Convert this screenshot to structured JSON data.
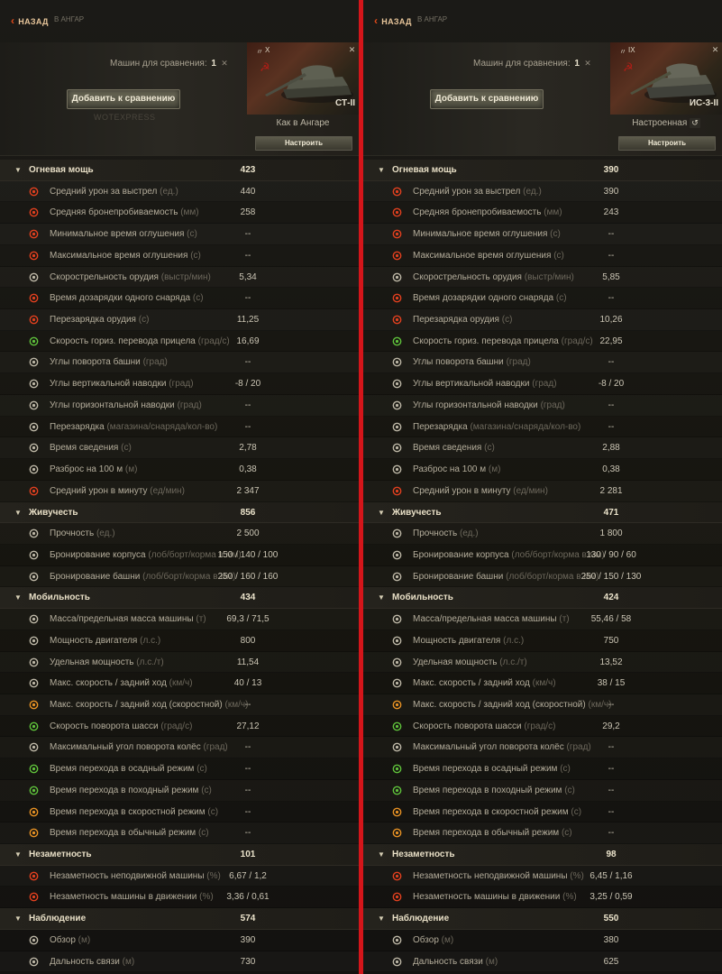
{
  "panels": [
    {
      "nav": {
        "back": "НАЗАД",
        "crumb": "В АНГАР"
      },
      "compare": {
        "label": "Машин для сравнения:",
        "count": "1",
        "add_button": "Добавить к сравнению",
        "watermark": "WOTEXPRESS"
      },
      "tank": {
        "type_mark": "〃",
        "tier": "X",
        "name": "СТ-II",
        "config": "Как в Ангаре",
        "reset": "",
        "setup_button": "Настроить"
      },
      "sections": [
        {
          "name": "Огневая мощь",
          "total": "423",
          "rows": [
            {
              "icon": "shell-damage-icon",
              "label": "Средний урон за выстрел",
              "unit": "(ед.)",
              "value": "440"
            },
            {
              "icon": "penetration-icon",
              "label": "Средняя бронепробиваемость",
              "unit": "(мм)",
              "value": "258"
            },
            {
              "icon": "stun-min-icon",
              "label": "Минимальное время оглушения",
              "unit": "(с)",
              "value": "--"
            },
            {
              "icon": "stun-max-icon",
              "label": "Максимальное время оглушения",
              "unit": "(с)",
              "value": "--"
            },
            {
              "icon": "rate-of-fire-icon",
              "label": "Скорострельность орудия",
              "unit": "(выстр/мин)",
              "value": "5,34"
            },
            {
              "icon": "shell-reload-icon",
              "label": "Время дозарядки одного снаряда",
              "unit": "(с)",
              "value": "--"
            },
            {
              "icon": "reload-icon",
              "label": "Перезарядка орудия",
              "unit": "(с)",
              "value": "11,25"
            },
            {
              "icon": "traverse-icon",
              "label": "Скорость гориз. перевода прицела",
              "unit": "(град/с)",
              "value": "16,69"
            },
            {
              "icon": "turret-angle-icon",
              "label": "Углы поворота башни",
              "unit": "(град)",
              "value": "--"
            },
            {
              "icon": "elevation-icon",
              "label": "Углы вертикальной наводки",
              "unit": "(град)",
              "value": "-8 / 20"
            },
            {
              "icon": "horizontal-aim-icon",
              "label": "Углы горизонтальной наводки",
              "unit": "(град)",
              "value": "--"
            },
            {
              "icon": "magazine-icon",
              "label": "Перезарядка",
              "unit": "(магазина/снаряда/кол-во)",
              "value": "--"
            },
            {
              "icon": "aim-time-icon",
              "label": "Время сведения",
              "unit": "(с)",
              "value": "2,78"
            },
            {
              "icon": "dispersion-icon",
              "label": "Разброс на 100 м",
              "unit": "(м)",
              "value": "0,38"
            },
            {
              "icon": "dpm-icon",
              "label": "Средний урон в минуту",
              "unit": "(ед/мин)",
              "value": "2 347"
            }
          ]
        },
        {
          "name": "Живучесть",
          "total": "856",
          "rows": [
            {
              "icon": "hp-icon",
              "label": "Прочность",
              "unit": "(ед.)",
              "value": "2 500"
            },
            {
              "icon": "hull-armor-icon",
              "label": "Бронирование корпуса",
              "unit": "(лоб/борт/корма в мм)",
              "value": "150 / 140 / 100"
            },
            {
              "icon": "turret-armor-icon",
              "label": "Бронирование башни",
              "unit": "(лоб/борт/корма в мм)",
              "value": "250 / 160 / 160"
            }
          ]
        },
        {
          "name": "Мобильность",
          "total": "434",
          "rows": [
            {
              "icon": "weight-icon",
              "label": "Масса/предельная масса машины",
              "unit": "(т)",
              "value": "69,3 / 71,5"
            },
            {
              "icon": "engine-icon",
              "label": "Мощность двигателя",
              "unit": "(л.с.)",
              "value": "800"
            },
            {
              "icon": "specific-power-icon",
              "label": "Удельная мощность",
              "unit": "(л.с./т)",
              "value": "11,54"
            },
            {
              "icon": "speed-icon",
              "label": "Макс. скорость / задний ход",
              "unit": "(км/ч)",
              "value": "40 / 13"
            },
            {
              "icon": "speed-mode-icon",
              "label": "Макс. скорость / задний ход (скоростной)",
              "unit": "(км/ч)",
              "value": "--"
            },
            {
              "icon": "hull-traverse-icon",
              "label": "Скорость поворота шасси",
              "unit": "(град/с)",
              "value": "27,12"
            },
            {
              "icon": "wheel-angle-icon",
              "label": "Максимальный угол поворота колёс",
              "unit": "(град)",
              "value": "--"
            },
            {
              "icon": "siege-mode-icon",
              "label": "Время перехода в осадный режим",
              "unit": "(с)",
              "value": "--"
            },
            {
              "icon": "travel-mode-icon",
              "label": "Время перехода в походный режим",
              "unit": "(с)",
              "value": "--"
            },
            {
              "icon": "fast-mode-icon",
              "label": "Время перехода в скоростной режим",
              "unit": "(с)",
              "value": "--"
            },
            {
              "icon": "normal-mode-icon",
              "label": "Время перехода в обычный режим",
              "unit": "(с)",
              "value": "--"
            }
          ]
        },
        {
          "name": "Незаметность",
          "total": "101",
          "rows": [
            {
              "icon": "camo-still-icon",
              "label": "Незаметность неподвижной машины",
              "unit": "(%)",
              "value": "6,67 / 1,2"
            },
            {
              "icon": "camo-moving-icon",
              "label": "Незаметность машины в движении",
              "unit": "(%)",
              "value": "3,36 / 0,61"
            }
          ]
        },
        {
          "name": "Наблюдение",
          "total": "574",
          "rows": [
            {
              "icon": "view-range-icon",
              "label": "Обзор",
              "unit": "(м)",
              "value": "390"
            },
            {
              "icon": "radio-range-icon",
              "label": "Дальность связи",
              "unit": "(м)",
              "value": "730"
            }
          ]
        }
      ]
    },
    {
      "nav": {
        "back": "НАЗАД",
        "crumb": "В АНГАР"
      },
      "compare": {
        "label": "Машин для сравнения:",
        "count": "1",
        "add_button": "Добавить к сравнению",
        "watermark": ""
      },
      "tank": {
        "type_mark": "〃",
        "tier": "IX",
        "name": "ИС-3-II",
        "config": "Настроенная",
        "reset": "↺",
        "setup_button": "Настроить"
      },
      "sections": [
        {
          "name": "Огневая мощь",
          "total": "390",
          "rows": [
            {
              "icon": "shell-damage-icon",
              "label": "Средний урон за выстрел",
              "unit": "(ед.)",
              "value": "390"
            },
            {
              "icon": "penetration-icon",
              "label": "Средняя бронепробиваемость",
              "unit": "(мм)",
              "value": "243"
            },
            {
              "icon": "stun-min-icon",
              "label": "Минимальное время оглушения",
              "unit": "(с)",
              "value": "--"
            },
            {
              "icon": "stun-max-icon",
              "label": "Максимальное время оглушения",
              "unit": "(с)",
              "value": "--"
            },
            {
              "icon": "rate-of-fire-icon",
              "label": "Скорострельность орудия",
              "unit": "(выстр/мин)",
              "value": "5,85"
            },
            {
              "icon": "shell-reload-icon",
              "label": "Время дозарядки одного снаряда",
              "unit": "(с)",
              "value": "--"
            },
            {
              "icon": "reload-icon",
              "label": "Перезарядка орудия",
              "unit": "(с)",
              "value": "10,26"
            },
            {
              "icon": "traverse-icon",
              "label": "Скорость гориз. перевода прицела",
              "unit": "(град/с)",
              "value": "22,95"
            },
            {
              "icon": "turret-angle-icon",
              "label": "Углы поворота башни",
              "unit": "(град)",
              "value": "--"
            },
            {
              "icon": "elevation-icon",
              "label": "Углы вертикальной наводки",
              "unit": "(град)",
              "value": "-8 / 20"
            },
            {
              "icon": "horizontal-aim-icon",
              "label": "Углы горизонтальной наводки",
              "unit": "(град)",
              "value": "--"
            },
            {
              "icon": "magazine-icon",
              "label": "Перезарядка",
              "unit": "(магазина/снаряда/кол-во)",
              "value": "--"
            },
            {
              "icon": "aim-time-icon",
              "label": "Время сведения",
              "unit": "(с)",
              "value": "2,88"
            },
            {
              "icon": "dispersion-icon",
              "label": "Разброс на 100 м",
              "unit": "(м)",
              "value": "0,38"
            },
            {
              "icon": "dpm-icon",
              "label": "Средний урон в минуту",
              "unit": "(ед/мин)",
              "value": "2 281"
            }
          ]
        },
        {
          "name": "Живучесть",
          "total": "471",
          "rows": [
            {
              "icon": "hp-icon",
              "label": "Прочность",
              "unit": "(ед.)",
              "value": "1 800"
            },
            {
              "icon": "hull-armor-icon",
              "label": "Бронирование корпуса",
              "unit": "(лоб/борт/корма в мм)",
              "value": "130 / 90 / 60"
            },
            {
              "icon": "turret-armor-icon",
              "label": "Бронирование башни",
              "unit": "(лоб/борт/корма в мм)",
              "value": "250 / 150 / 130"
            }
          ]
        },
        {
          "name": "Мобильность",
          "total": "424",
          "rows": [
            {
              "icon": "weight-icon",
              "label": "Масса/предельная масса машины",
              "unit": "(т)",
              "value": "55,46 / 58"
            },
            {
              "icon": "engine-icon",
              "label": "Мощность двигателя",
              "unit": "(л.с.)",
              "value": "750"
            },
            {
              "icon": "specific-power-icon",
              "label": "Удельная мощность",
              "unit": "(л.с./т)",
              "value": "13,52"
            },
            {
              "icon": "speed-icon",
              "label": "Макс. скорость / задний ход",
              "unit": "(км/ч)",
              "value": "38 / 15"
            },
            {
              "icon": "speed-mode-icon",
              "label": "Макс. скорость / задний ход (скоростной)",
              "unit": "(км/ч)",
              "value": "--"
            },
            {
              "icon": "hull-traverse-icon",
              "label": "Скорость поворота шасси",
              "unit": "(град/с)",
              "value": "29,2"
            },
            {
              "icon": "wheel-angle-icon",
              "label": "Максимальный угол поворота колёс",
              "unit": "(град)",
              "value": "--"
            },
            {
              "icon": "siege-mode-icon",
              "label": "Время перехода в осадный режим",
              "unit": "(с)",
              "value": "--"
            },
            {
              "icon": "travel-mode-icon",
              "label": "Время перехода в походный режим",
              "unit": "(с)",
              "value": "--"
            },
            {
              "icon": "fast-mode-icon",
              "label": "Время перехода в скоростной режим",
              "unit": "(с)",
              "value": "--"
            },
            {
              "icon": "normal-mode-icon",
              "label": "Время перехода в обычный режим",
              "unit": "(с)",
              "value": "--"
            }
          ]
        },
        {
          "name": "Незаметность",
          "total": "98",
          "rows": [
            {
              "icon": "camo-still-icon",
              "label": "Незаметность неподвижной машины",
              "unit": "(%)",
              "value": "6,45 / 1,16"
            },
            {
              "icon": "camo-moving-icon",
              "label": "Незаметность машины в движении",
              "unit": "(%)",
              "value": "3,25 / 0,59"
            }
          ]
        },
        {
          "name": "Наблюдение",
          "total": "550",
          "rows": [
            {
              "icon": "view-range-icon",
              "label": "Обзор",
              "unit": "(м)",
              "value": "380"
            },
            {
              "icon": "radio-range-icon",
              "label": "Дальность связи",
              "unit": "(м)",
              "value": "625"
            }
          ]
        }
      ]
    }
  ],
  "colors": {
    "accent_red": "#d4151a",
    "icon_red": "#e2401f",
    "icon_grey": "#bdb7a6",
    "icon_green": "#5fc23b",
    "icon_orange": "#e89224"
  }
}
